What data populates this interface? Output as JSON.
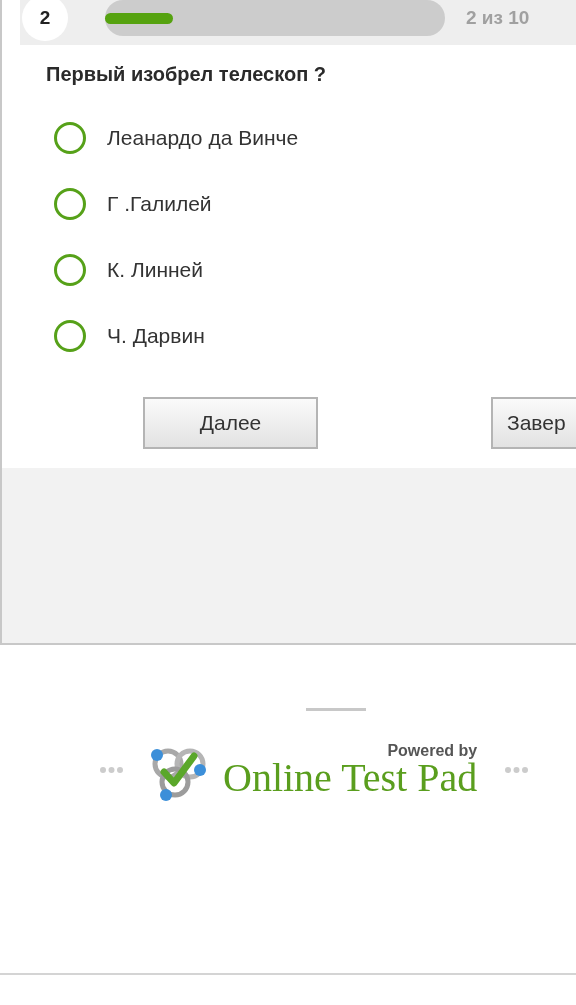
{
  "question_number": "2",
  "progress": {
    "level": 0.2,
    "label": "2 из 10"
  },
  "question": "Первый изобрел телескоп ?",
  "options": [
    {
      "label": "Леанардо да Винче",
      "selected": false
    },
    {
      "label": "Г .Галилей",
      "selected": false
    },
    {
      "label": "К. Линней",
      "selected": false
    },
    {
      "label": "Ч. Дарвин",
      "selected": false
    }
  ],
  "buttons": [
    "Далее",
    "Завер"
  ],
  "footer": {
    "powered_by": "Powered by",
    "brand": "Online Test Pad"
  }
}
